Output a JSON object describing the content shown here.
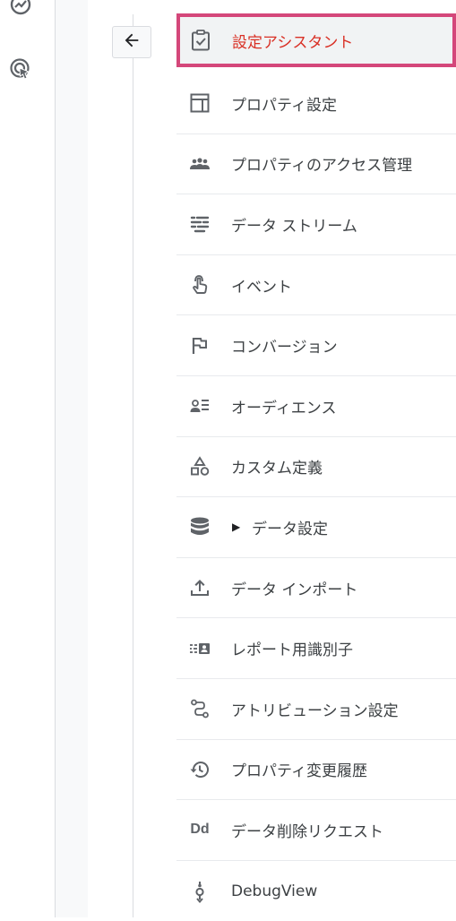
{
  "leftnav": {
    "icons": [
      "insights-icon",
      "advertising-target-icon"
    ]
  },
  "back_button": {
    "icon": "arrow-left-icon"
  },
  "menu": {
    "items": [
      {
        "label": "設定アシスタント",
        "icon": "clipboard-check-icon",
        "active": true
      },
      {
        "label": "プロパティ設定",
        "icon": "property-layout-icon"
      },
      {
        "label": "プロパティのアクセス管理",
        "icon": "people-group-icon"
      },
      {
        "label": "データ ストリーム",
        "icon": "data-stream-icon"
      },
      {
        "label": "イベント",
        "icon": "touch-hand-icon"
      },
      {
        "label": "コンバージョン",
        "icon": "flag-icon"
      },
      {
        "label": "オーディエンス",
        "icon": "audience-list-icon"
      },
      {
        "label": "カスタム定義",
        "icon": "shapes-icon"
      },
      {
        "label": "データ設定",
        "icon": "database-icon",
        "expand": "▶"
      },
      {
        "label": "データ インポート",
        "icon": "upload-icon"
      },
      {
        "label": "レポート用識別子",
        "icon": "report-identity-icon"
      },
      {
        "label": "アトリビューション設定",
        "icon": "attribution-path-icon"
      },
      {
        "label": "プロパティ変更履歴",
        "icon": "history-icon"
      },
      {
        "label": "データ削除リクエスト",
        "icon": "data-deletion-icon",
        "icon_text": "Dd"
      },
      {
        "label": "DebugView",
        "icon": "debug-icon"
      }
    ]
  },
  "colors": {
    "highlight_border": "#d4477a",
    "active_text": "#d93025",
    "icon_gray": "#5f6368",
    "divider": "#e8eaed"
  }
}
